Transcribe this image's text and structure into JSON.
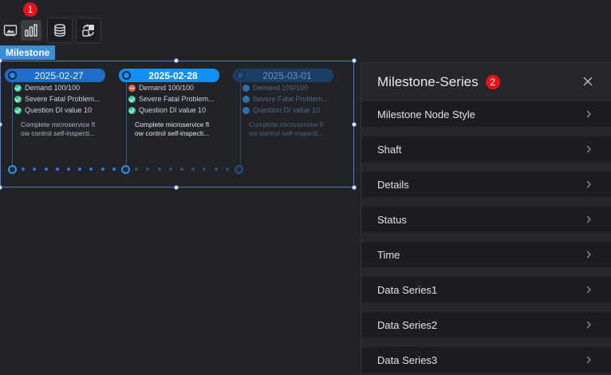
{
  "toolbar": {
    "icons": [
      "image-icon",
      "chart-icon",
      "database-icon",
      "interaction-icon"
    ],
    "badge1": "1"
  },
  "component": {
    "tag": "Milestone"
  },
  "milestones": [
    {
      "date": "2025-02-27",
      "state": "past",
      "items": [
        {
          "status": "ok",
          "text": "Demand 100/100"
        },
        {
          "status": "ok",
          "text": "Severe Fatal Problem..."
        },
        {
          "status": "ok",
          "text": "Question DI value 10"
        }
      ],
      "desc": "Complete microservice fl ow control self-inspecti..."
    },
    {
      "date": "2025-02-28",
      "state": "current",
      "items": [
        {
          "status": "err",
          "text": "Demand 100/100"
        },
        {
          "status": "ok",
          "text": "Severe Fatal Problem..."
        },
        {
          "status": "ok",
          "text": "Question DI value 10"
        }
      ],
      "desc": "Complete microservice fl ow control self-inspecti..."
    },
    {
      "date": "2025-03-01",
      "state": "future",
      "items": [
        {
          "status": "todo",
          "text": "Demand 100/100"
        },
        {
          "status": "todo",
          "text": "Severe Fatal Problem..."
        },
        {
          "status": "todo",
          "text": "Question DI value 10"
        }
      ],
      "desc": "Complete microservice fl ow control self-inspecti..."
    }
  ],
  "panel": {
    "title": "Milestone-Series",
    "badge2": "2",
    "rows": [
      "Milestone Node Style",
      "Shaft",
      "Details",
      "Status",
      "Time",
      "Data Series1",
      "Data Series2",
      "Data Series3"
    ]
  },
  "colors": {
    "accent": "#1390f5",
    "badge": "#e8121b",
    "ok": "#3ec79a",
    "error": "#e1665b"
  }
}
